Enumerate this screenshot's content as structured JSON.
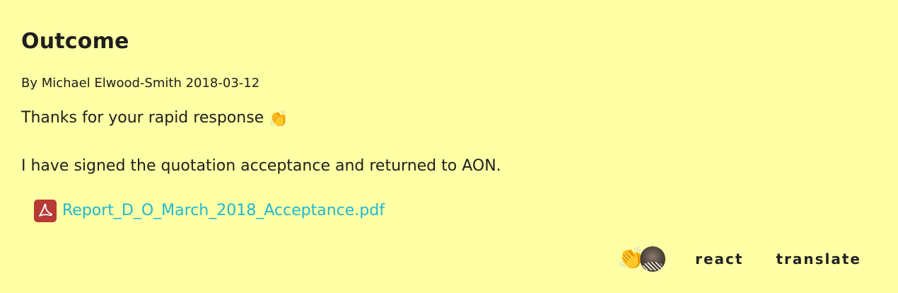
{
  "post": {
    "title": "Outcome",
    "byline": "By Michael Elwood-Smith 2018-03-12",
    "message_line1": "Thanks for your rapid response",
    "message_line1_emoji": "👏",
    "message_line2": "I have signed the quotation acceptance and returned to AON.",
    "attachment": {
      "filename": "Report_D_O_March_2018_Acceptance.pdf",
      "icon": "pdf-file-icon",
      "icon_color": "#b73a34",
      "link_color": "#1fb7d6"
    }
  },
  "footer": {
    "reaction_emoji": "👏",
    "reaction_avatar": "user-avatar",
    "react_label": "react",
    "translate_label": "translate"
  },
  "colors": {
    "background": "#ffffa5",
    "text": "#1e1e1e"
  }
}
